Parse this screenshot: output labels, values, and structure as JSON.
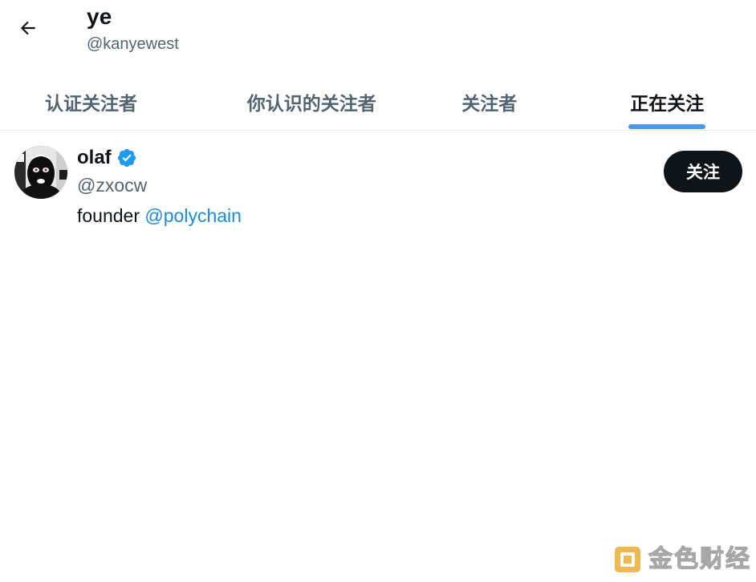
{
  "header": {
    "back_icon": "arrow-left-icon",
    "profile_name": "ye",
    "profile_handle": "@kanyewest"
  },
  "tabs": [
    {
      "label": "认证关注者",
      "active": false
    },
    {
      "label": "你认识的关注者",
      "active": false
    },
    {
      "label": "关注者",
      "active": false
    },
    {
      "label": "正在关注",
      "active": true
    }
  ],
  "user_list": [
    {
      "name": "olaf",
      "verified": true,
      "handle": "@zxocw",
      "bio_text": "founder",
      "bio_mention": "@polychain",
      "follow_label": "关注"
    }
  ],
  "watermark": {
    "text": "金色财经"
  },
  "colors": {
    "accent": "#4a99e9",
    "mention": "#1d8ad9",
    "verified": "#1d9bf0",
    "primary_text": "#0f1419",
    "secondary_text": "#536471",
    "follow_button_bg": "#0f1419"
  }
}
